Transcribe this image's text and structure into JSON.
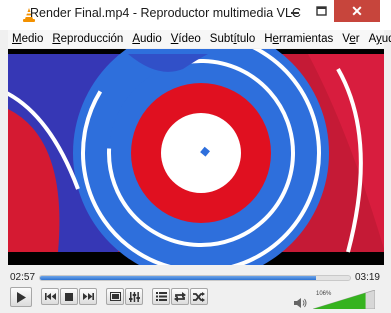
{
  "window": {
    "title": "Render Final.mp4 - Reproductor multimedia VLC",
    "app_icon": "vlc-cone-icon",
    "controls": [
      "minimize-icon",
      "maximize-icon",
      "close-icon"
    ],
    "close_color": "#c7453c"
  },
  "menu": {
    "items": [
      {
        "pre": "",
        "u": "M",
        "post": "edio"
      },
      {
        "pre": "",
        "u": "R",
        "post": "eproducción"
      },
      {
        "pre": "",
        "u": "A",
        "post": "udio"
      },
      {
        "pre": "",
        "u": "V",
        "post": "ídeo"
      },
      {
        "pre": "Subt",
        "u": "í",
        "post": "tulo"
      },
      {
        "pre": "H",
        "u": "e",
        "post": "rramientas"
      },
      {
        "pre": "V",
        "u": "e",
        "post": "r"
      },
      {
        "pre": "A",
        "u": "y",
        "post": "uda"
      }
    ]
  },
  "video": {
    "frame_colors": {
      "background_left": "#3b3fbf",
      "background_right": "#d21f4a",
      "ring_blue": "#2e6fdc",
      "ring_red": "#e01020",
      "center": "#ffffff"
    }
  },
  "playback": {
    "elapsed": "02:57",
    "total": "03:19",
    "progress_fraction": 0.89,
    "accent": "#2d73d3"
  },
  "toolbar": {
    "buttons": [
      {
        "name": "play-button",
        "icon": "play-icon"
      },
      {
        "name": "previous-button",
        "icon": "previous-icon"
      },
      {
        "name": "stop-button",
        "icon": "stop-icon"
      },
      {
        "name": "next-button",
        "icon": "next-icon"
      },
      {
        "name": "fullscreen-button",
        "icon": "fullscreen-icon"
      },
      {
        "name": "extended-settings-button",
        "icon": "equalizer-icon"
      },
      {
        "name": "playlist-button",
        "icon": "playlist-icon"
      },
      {
        "name": "loop-button",
        "icon": "loop-icon"
      },
      {
        "name": "shuffle-button",
        "icon": "shuffle-icon"
      }
    ]
  },
  "volume": {
    "label": "106%",
    "level_fraction": 1.06,
    "icon": "speaker-icon",
    "color": "#36b31f"
  }
}
